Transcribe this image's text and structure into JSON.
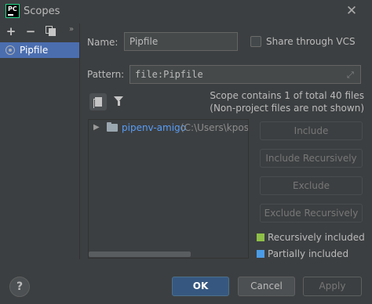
{
  "window": {
    "app_icon": "pycharm-logo-icon",
    "app_icon_text": "PC",
    "title": "Scopes",
    "close_icon": "close-icon"
  },
  "toolbar": {
    "add_icon": "+",
    "remove_icon": "−",
    "copy_icon": "copy-icon",
    "more_icon": "»"
  },
  "scopes_list": [
    {
      "label": "Pipfile",
      "icon": "scope-icon",
      "selected": true
    }
  ],
  "form": {
    "name_label": "Name:",
    "name_value": "Pipfile",
    "share_label": "Share through VCS",
    "share_checked": false,
    "pattern_label": "Pattern:",
    "pattern_value": "file:Pipfile"
  },
  "scope_info": {
    "line1": "Scope contains 1 of total 40 files",
    "line2": "(Non-project files are not shown)"
  },
  "tree": {
    "items": [
      {
        "name": "pipenv-amigo",
        "path": "(C:\\Users\\kpost"
      }
    ]
  },
  "actions": {
    "include": "Include",
    "include_recursively": "Include Recursively",
    "exclude": "Exclude",
    "exclude_recursively": "Exclude Recursively"
  },
  "legend": [
    {
      "label": "Recursively included",
      "color": "#8ebf47"
    },
    {
      "label": "Partially included",
      "color": "#4b9ce6"
    }
  ],
  "buttons": {
    "help": "?",
    "ok": "OK",
    "cancel": "Cancel",
    "apply": "Apply"
  },
  "colors": {
    "background": "#3c3f41",
    "selection": "#4b6eaf",
    "link": "#589df6",
    "ok_button": "#365880"
  }
}
